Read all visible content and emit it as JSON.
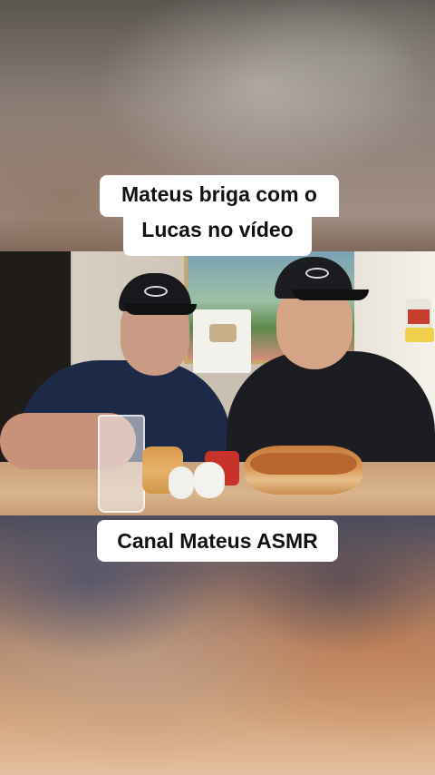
{
  "captions": {
    "top_line1": "Mateus briga com o",
    "top_line2": "Lucas no vídeo",
    "bottom": "Canal Mateus ASMR"
  },
  "colors": {
    "caption_background": "#ffffff",
    "caption_text": "#111111"
  }
}
